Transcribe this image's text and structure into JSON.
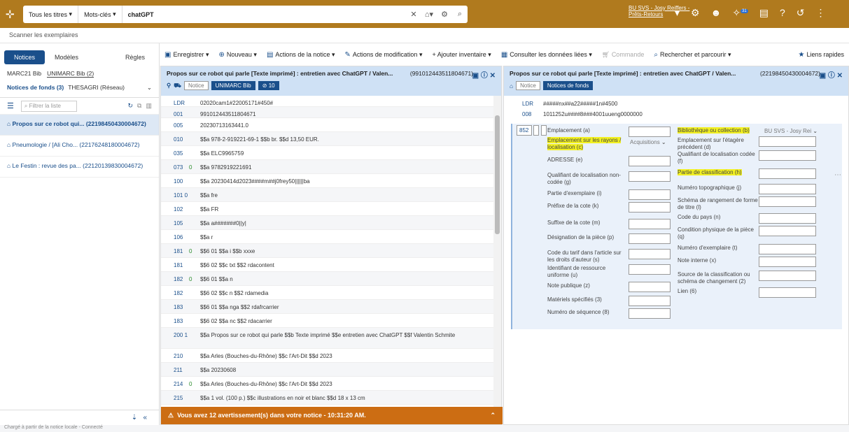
{
  "topbar": {
    "scope": "Tous les titres",
    "search_type": "Mots-clés",
    "query": "chatGPT",
    "user_line1": "BU SVS - Josy Reiffers -",
    "user_line2": "Prêts-Retours",
    "badge": "31"
  },
  "subbar": {
    "label": "Scanner les exemplaires"
  },
  "left": {
    "tabs": [
      "Notices",
      "Modèles",
      "Règles"
    ],
    "bibtabs": [
      "MARC21 Bib",
      "UNIMARC Bib (2)"
    ],
    "fonds_label": "Notices de fonds (3)",
    "fonds_other": "THESAGRI (Réseau)",
    "filter_placeholder": "Filtrer la liste",
    "items": [
      "Propos sur ce robot qui... (22198450430004672)",
      "Pneumologie / [Ali Cho... (22176248180004672)",
      "Le Festin : revue des pa... (22120139830004672)"
    ]
  },
  "toolbar": {
    "save": "Enregistrer",
    "new": "Nouveau",
    "record_actions": "Actions de la notice",
    "edit_actions": "Actions de modification",
    "add_inventory": "Ajouter inventaire",
    "linked_data": "Consulter les données liées",
    "order": "Commande",
    "search_browse": "Rechercher et parcourir",
    "quick_links": "Liens rapides"
  },
  "mid": {
    "title": "Propos sur ce robot qui parle [Texte imprimé] : entretien avec ChatGPT / Valen...",
    "id": "(991012443511804671)",
    "chip_notice": "Notice",
    "chip_format": "UNIMARC Bib",
    "chip_count": "10",
    "rows": [
      {
        "tag": "LDR",
        "ind": "",
        "val": "02020cam1#22005171#450#"
      },
      {
        "tag": "001",
        "ind": "",
        "val": "991012443511804671"
      },
      {
        "tag": "005",
        "ind": "",
        "val": "20230713163441.0"
      },
      {
        "tag": "010",
        "ind": "",
        "val": "$$a 978-2-919221-69-1 $$b br. $$d 13,50 EUR."
      },
      {
        "tag": "035",
        "ind": "",
        "val": "$$a ELC9965759"
      },
      {
        "tag": "073",
        "ind": "0",
        "val": "$$a 9782919221691"
      },
      {
        "tag": "100",
        "ind": "",
        "val": "$$a 20230414d2023####m##j0frey50||||||ba"
      },
      {
        "tag": "101 0",
        "ind": "",
        "val": "$$a fre"
      },
      {
        "tag": "102",
        "ind": "",
        "val": "$$a FR"
      },
      {
        "tag": "105",
        "ind": "",
        "val": "$$a a#######0||y|"
      },
      {
        "tag": "106",
        "ind": "",
        "val": "$$a r"
      },
      {
        "tag": "181",
        "ind": "0",
        "val": "$$6 01 $$a i $$b xxxe"
      },
      {
        "tag": "181",
        "ind": "",
        "val": "$$6 02 $$c txt $$2 rdacontent"
      },
      {
        "tag": "182",
        "ind": "0",
        "val": "$$6 01 $$a n"
      },
      {
        "tag": "182",
        "ind": "",
        "val": "$$6 02 $$c n $$2 rdamedia"
      },
      {
        "tag": "183",
        "ind": "",
        "val": "$$6 01 $$a nga $$2 rdafrcarrier"
      },
      {
        "tag": "183",
        "ind": "",
        "val": "$$6 02 $$a nc $$2 rdacarrier"
      },
      {
        "tag": "200 1",
        "ind": "",
        "val": "$$a Propos sur ce robot qui parle $$b Texte imprimé $$e entretien avec ChatGPT $$f Valentin Schmite"
      },
      {
        "tag": "210",
        "ind": "",
        "val": "$$a Arles (Bouches-du-Rhône) $$c l'Art-Dit $$d 2023"
      },
      {
        "tag": "211",
        "ind": "",
        "val": "$$a 20230608"
      },
      {
        "tag": "214",
        "ind": "0",
        "val": "$$a Arles (Bouches-du-Rhône) $$c l'Art-Dit $$d 2023"
      },
      {
        "tag": "215",
        "ind": "",
        "val": "$$a 1 vol. (100 p.) $$c illustrations en noir et blanc $$d 18 x 13 cm"
      }
    ],
    "warning": "Vous avez 12 avertissement(s) dans votre notice - 10:31:20 AM."
  },
  "right": {
    "title": "Propos sur ce robot qui parle [Texte imprimé] : entretien avec ChatGPT / Valen...",
    "id": "(22198450430004672)",
    "chip_notice": "Notice",
    "chip_fonds": "Notices de fonds",
    "rows": [
      {
        "tag": "LDR",
        "val": "#####nx##a22#####1n#4500"
      },
      {
        "tag": "008",
        "val": "1011252u####8###4001uueng0000000"
      }
    ],
    "field_tag": "852",
    "fields_left": [
      "Emplacement (a)",
      "Emplacement sur les rayons / localisation (c)",
      "ADRESSE (e)",
      "Qualifiant de localisation non-codée (g)",
      "Partie d'exemplaire (i)",
      "Préfixe de la cote (k)",
      "Suffixe de la cote (m)",
      "Désignation de la pièce (p)",
      "Code du tarif dans l'article sur les droits d'auteur (s)",
      "Identifiant de ressource uniforme (u)",
      "Note publique (z)",
      "Matériels spécifiés (3)",
      "Numéro de séquence (8)"
    ],
    "fields_right": [
      "Bibliothèque ou collection (b)",
      "Emplacement sur l'étagère précédent (d)",
      "Qualifiant de localisation codée (f)",
      "Partie de classification (h)",
      "Numéro topographique (j)",
      "Schéma de rangement de forme de titre (l)",
      "Code du pays (n)",
      "Condition physique de la pièce (q)",
      "Numéro d'exemplaire (t)",
      "Note interne (x)",
      "Source de la classification ou schéma de changement (2)",
      "Lien (6)"
    ],
    "library_value": "BU SVS - Josy Rei",
    "location_value": "Acquisitions"
  },
  "status": "Chargé à partir de la notice locale - Connecté"
}
